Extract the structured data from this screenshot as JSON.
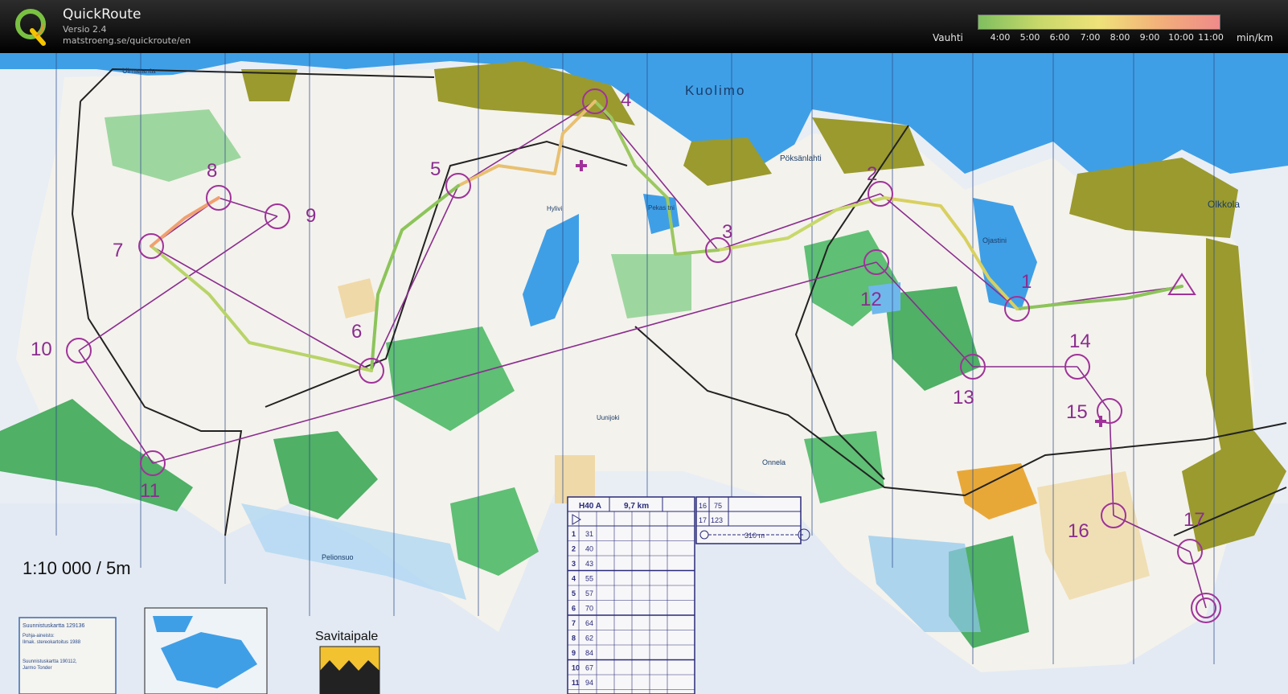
{
  "app": {
    "title": "QuickRoute",
    "version": "Versio 2.4",
    "url": "matstroeng.se/quickroute/en"
  },
  "pace_legend": {
    "label": "Vauhti",
    "ticks": [
      "4:00",
      "5:00",
      "6:00",
      "7:00",
      "8:00",
      "9:00",
      "10:00",
      "11:00"
    ],
    "unit": "min/km",
    "gradient_colors": [
      "#7fbf5f",
      "#c8d86a",
      "#efe27a",
      "#f2b07a",
      "#f08a8a"
    ]
  },
  "map": {
    "scale_text": "1:10 000 / 5m",
    "place_names": {
      "lake": "Kuolimo",
      "bay": "Pöksänlahti",
      "village": "Olkkola",
      "shore": "Uimaranta",
      "lake2": "Ojastini",
      "pond1": "Hylivi",
      "pond2": "Pekas tni",
      "brook": "Uunijoki",
      "field": "Onnela",
      "marsh": "Pelionsuo",
      "town": "Savitaipale"
    },
    "controls": [
      "1",
      "2",
      "3",
      "4",
      "5",
      "6",
      "7",
      "8",
      "9",
      "10",
      "11",
      "12",
      "13",
      "14",
      "15",
      "16",
      "17"
    ],
    "description_sheet": {
      "class": "H40 A",
      "distance": "9,7 km",
      "rows": [
        {
          "n": "1",
          "code": "31"
        },
        {
          "n": "2",
          "code": "40"
        },
        {
          "n": "3",
          "code": "43"
        },
        {
          "n": "4",
          "code": "55"
        },
        {
          "n": "5",
          "code": "57"
        },
        {
          "n": "6",
          "code": "70"
        },
        {
          "n": "7",
          "code": "64"
        },
        {
          "n": "8",
          "code": "62"
        },
        {
          "n": "9",
          "code": "84"
        },
        {
          "n": "10",
          "code": "67"
        },
        {
          "n": "11",
          "code": "94"
        }
      ],
      "rows_right": [
        {
          "n": "16",
          "code": "75"
        },
        {
          "n": "17",
          "code": "123"
        }
      ],
      "finish_distance": "310 m"
    },
    "info_box": {
      "title": "Suunnistuskartta 129136",
      "line1": "Pohja-aineisto:",
      "line2": "Ilmak. stereokartoitus 1988",
      "line3": "Suunnistuskartta 190112,",
      "line4": "Jarmo Tonder"
    }
  }
}
